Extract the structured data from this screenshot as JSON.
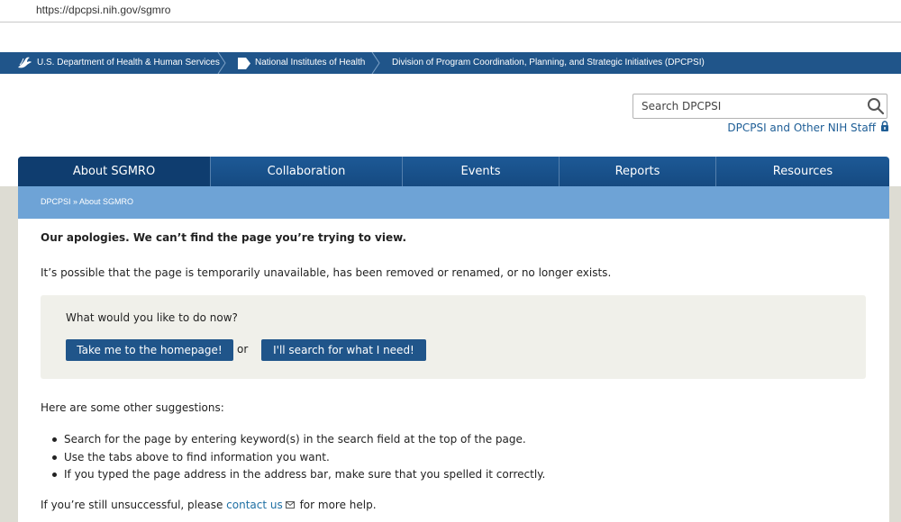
{
  "browser": {
    "url": "https://dpcpsi.nih.gov/sgmro"
  },
  "top_bar": {
    "hhs": "U.S. Department of Health & Human Services",
    "nih": "National Institutes of Health",
    "division": "Division of Program Coordination, Planning, and Strategic Initiatives (DPCPSI)"
  },
  "search": {
    "placeholder": "Search DPCPSI"
  },
  "staff_link": "DPCPSI and Other NIH Staff",
  "nav": {
    "items": [
      "About SGMRO",
      "Collaboration",
      "Events",
      "Reports",
      "Resources"
    ],
    "active": "About SGMRO"
  },
  "breadcrumb": "DPCPSI » About SGMRO",
  "main": {
    "heading": "Our apologies. We can’t find the page you’re trying to view.",
    "paragraph": "It’s possible that the page is temporarily unavailable, has been removed or renamed, or no longer exists.",
    "panel_question": "What would you like to do now?",
    "home_button": "Take me to the homepage!",
    "or_text": "or",
    "search_button": "I'll search for what I need!",
    "suggestions_heading": "Here are some other suggestions:",
    "suggestions": [
      "Search for the page by entering keyword(s) in the search field at the top of the page.",
      "Use the tabs above to find information you want.",
      "If you typed the page address in the address bar, make sure that you spelled it correctly."
    ],
    "footer_prefix": "If you’re still unsuccessful, please ",
    "footer_link": "contact us",
    "footer_suffix": " for more help."
  },
  "colors": {
    "header_blue": "#20558a",
    "nav_active": "#0f3d6f",
    "breadcrumb_blue": "#6ea3d6",
    "link": "#1e6fa3",
    "page_grey": "#dddcd3"
  }
}
